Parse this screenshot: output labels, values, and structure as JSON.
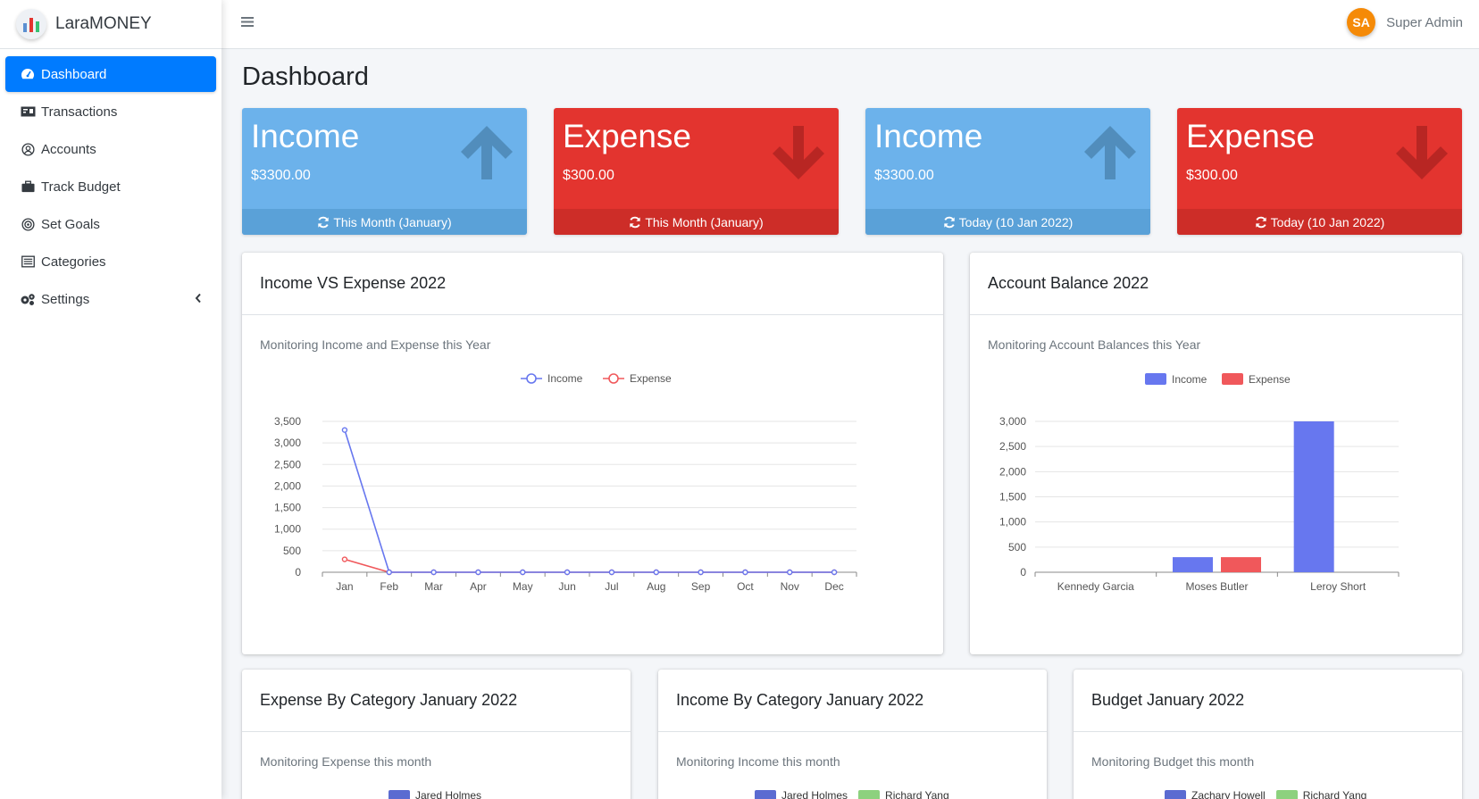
{
  "app": {
    "brand": "LaraMONEY"
  },
  "sidebar": {
    "items": [
      {
        "label": "Dashboard",
        "icon": "tachometer-icon",
        "active": true
      },
      {
        "label": "Transactions",
        "icon": "money-bill-icon"
      },
      {
        "label": "Accounts",
        "icon": "user-circle-icon"
      },
      {
        "label": "Track Budget",
        "icon": "briefcase-icon"
      },
      {
        "label": "Set Goals",
        "icon": "bullseye-icon"
      },
      {
        "label": "Categories",
        "icon": "list-alt-icon"
      },
      {
        "label": "Settings",
        "icon": "cogs-icon",
        "has_submenu": true
      }
    ]
  },
  "topbar": {
    "user_initials": "SA",
    "user_name": "Super Admin"
  },
  "page": {
    "title": "Dashboard"
  },
  "boxes": [
    {
      "title": "Income",
      "amount": "$3300.00",
      "footer": "This Month (January)",
      "kind": "income"
    },
    {
      "title": "Expense",
      "amount": "$300.00",
      "footer": "This Month (January)",
      "kind": "expense"
    },
    {
      "title": "Income",
      "amount": "$3300.00",
      "footer": "Today (10 Jan 2022)",
      "kind": "income"
    },
    {
      "title": "Expense",
      "amount": "$300.00",
      "footer": "Today (10 Jan 2022)",
      "kind": "expense"
    }
  ],
  "cards": {
    "income_vs_expense": {
      "title": "Income VS Expense 2022",
      "subtitle": "Monitoring Income and Expense this Year"
    },
    "account_balance": {
      "title": "Account Balance 2022",
      "subtitle": "Monitoring Account Balances this Year"
    },
    "expense_by_category": {
      "title": "Expense By Category January 2022",
      "subtitle": "Monitoring Expense this month",
      "legend": [
        "Jared Holmes"
      ]
    },
    "income_by_category": {
      "title": "Income By Category January 2022",
      "subtitle": "Monitoring Income this month",
      "legend": [
        "Jared Holmes",
        "Richard Yang"
      ]
    },
    "budget": {
      "title": "Budget January 2022",
      "subtitle": "Monitoring Budget this month",
      "legend": [
        "Zachary Howell",
        "Richard Yang"
      ]
    }
  },
  "colors": {
    "income": "#6777ef",
    "expense": "#f0585b",
    "primary": "#007bff",
    "box_income": "#6cb2eb",
    "box_expense": "#e3342f",
    "legend_blue": "#5b6bd1",
    "legend_green": "#8dd17e"
  },
  "chart_data": [
    {
      "type": "line",
      "title": "",
      "x": [
        "Jan",
        "Feb",
        "Mar",
        "Apr",
        "May",
        "Jun",
        "Jul",
        "Aug",
        "Sep",
        "Oct",
        "Nov",
        "Dec"
      ],
      "series": [
        {
          "name": "Income",
          "values": [
            3300,
            0,
            0,
            0,
            0,
            0,
            0,
            0,
            0,
            0,
            0,
            0
          ]
        },
        {
          "name": "Expense",
          "values": [
            300,
            0,
            0,
            0,
            0,
            0,
            0,
            0,
            0,
            0,
            0,
            0
          ]
        }
      ],
      "ylim": [
        0,
        3500
      ],
      "yticks": [
        0,
        500,
        1000,
        1500,
        2000,
        2500,
        3000,
        3500
      ],
      "grid": true,
      "legend": "top-center"
    },
    {
      "type": "bar",
      "title": "",
      "categories": [
        "Kennedy Garcia",
        "Moses Butler",
        "Leroy Short"
      ],
      "series": [
        {
          "name": "Income",
          "values": [
            0,
            300,
            3000
          ]
        },
        {
          "name": "Expense",
          "values": [
            0,
            300,
            0
          ]
        }
      ],
      "ylim": [
        0,
        3000
      ],
      "yticks": [
        0,
        500,
        1000,
        1500,
        2000,
        2500,
        3000
      ],
      "grid": true,
      "legend": "top-center"
    }
  ]
}
